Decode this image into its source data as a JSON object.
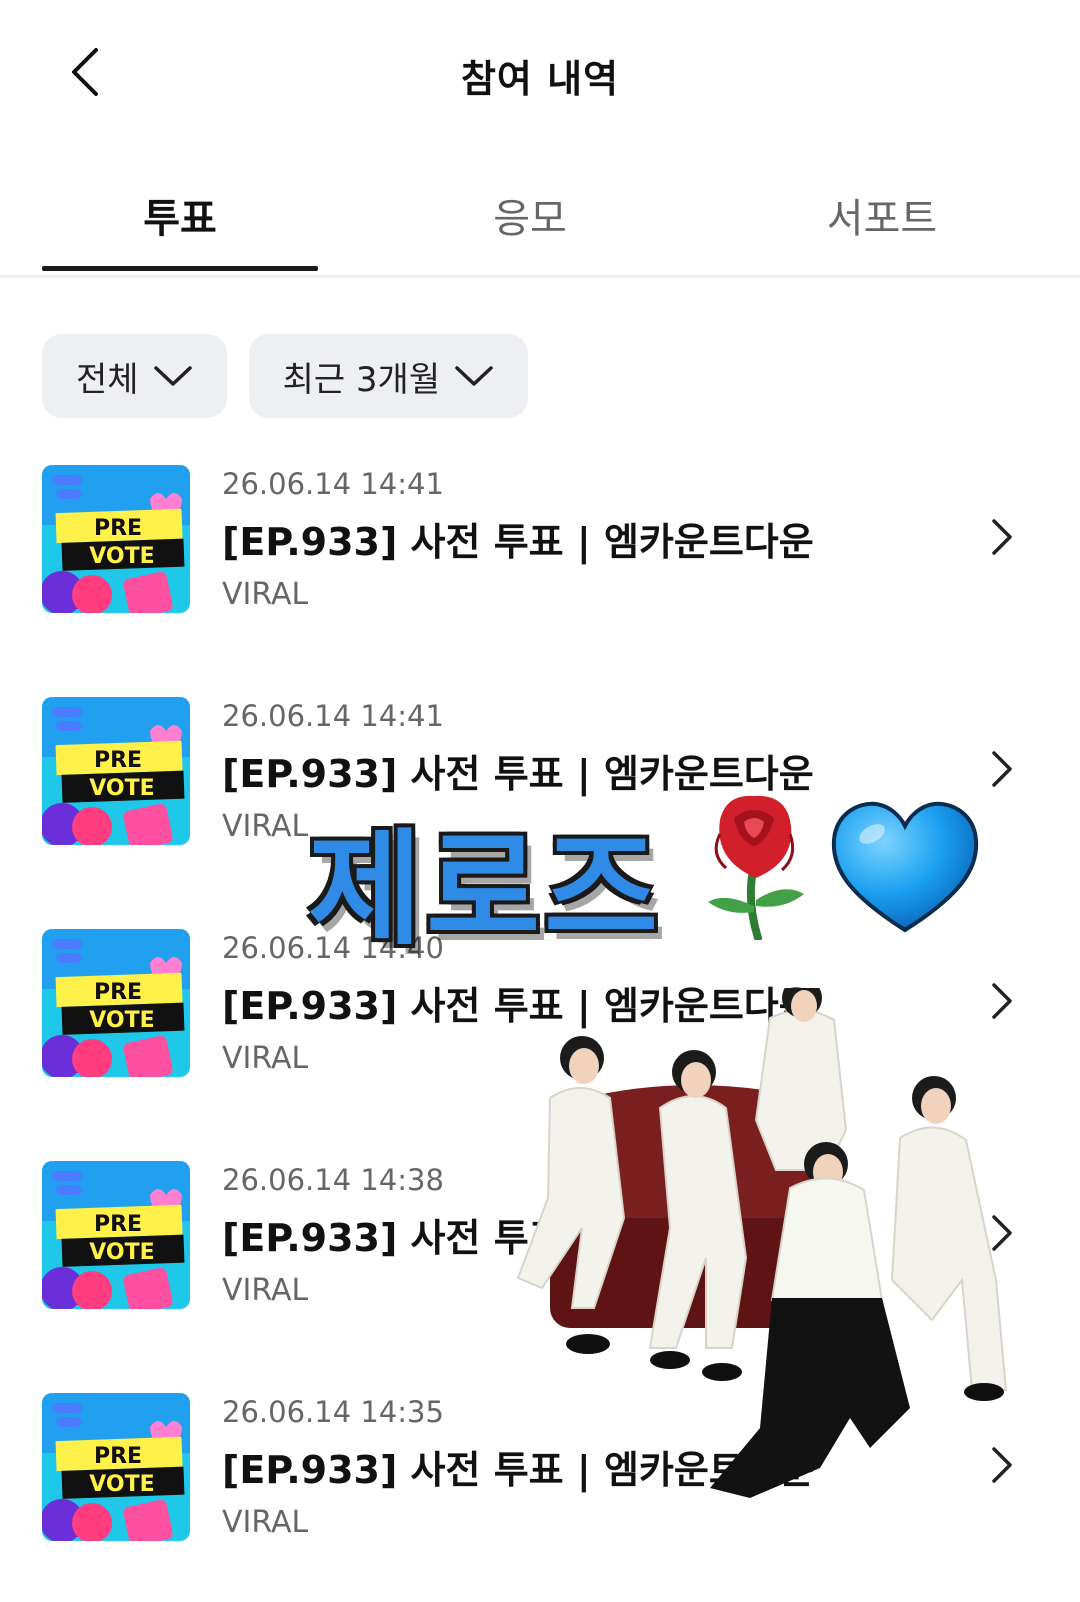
{
  "header": {
    "title": "참여 내역"
  },
  "tabs": [
    {
      "label": "투표",
      "active": true
    },
    {
      "label": "응모",
      "active": false
    },
    {
      "label": "서포트",
      "active": false
    }
  ],
  "filters": [
    {
      "label": "전체"
    },
    {
      "label": "최근 3개월"
    }
  ],
  "thumbnail": {
    "line1": "PRE",
    "line2": "VOTE"
  },
  "items": [
    {
      "date": "26.06.14 14:41",
      "title": "[EP.933] 사전 투표 | 엠카운트다운",
      "source": "VIRAL"
    },
    {
      "date": "26.06.14 14:41",
      "title": "[EP.933] 사전 투표 | 엠카운트다운",
      "source": "VIRAL"
    },
    {
      "date": "26.06.14 14:40",
      "title": "[EP.933] 사전 투표 | 엠카운트다운",
      "source": "VIRAL"
    },
    {
      "date": "26.06.14 14:38",
      "title": "[EP.933] 사전 투표 | 엠카운트다운",
      "source": "VIRAL"
    },
    {
      "date": "26.06.14 14:35",
      "title": "[EP.933] 사전 투표 | 엠카운트다운",
      "source": "VIRAL"
    }
  ],
  "overlay": {
    "text": "제로즈",
    "emojis": [
      "rose-icon",
      "blue-heart-icon"
    ]
  },
  "colors": {
    "sticker_text": "#2f8be6",
    "heart": "#1aa0f0",
    "filter_bg": "#eeeff2"
  }
}
